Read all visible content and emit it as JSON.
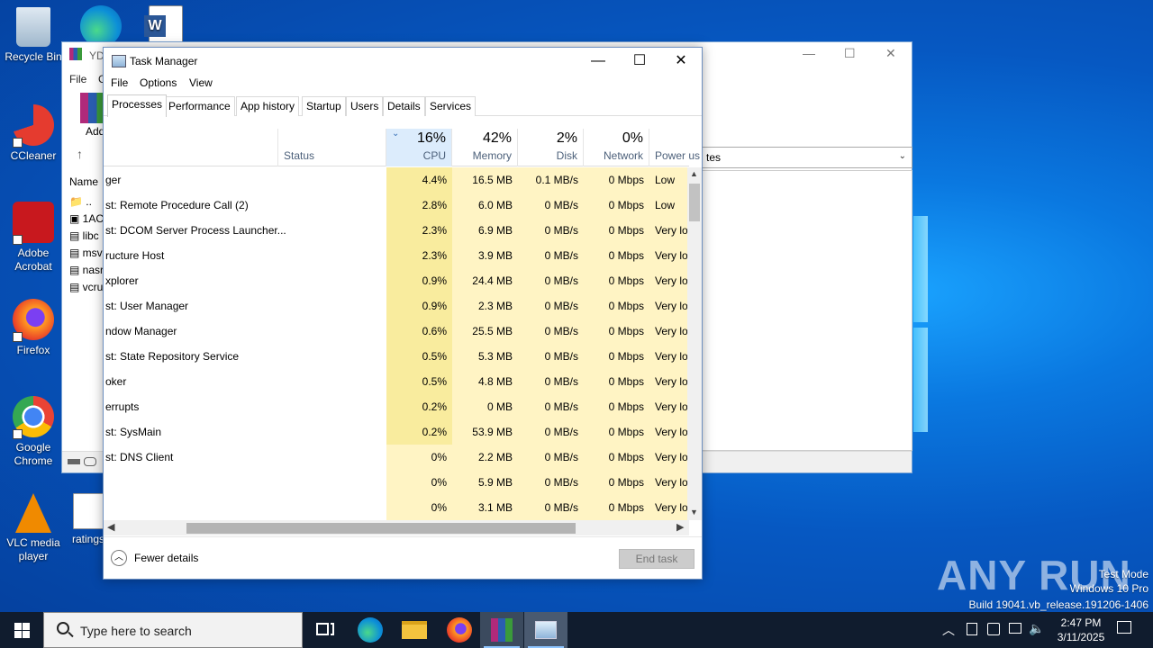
{
  "desktop": {
    "icons": [
      {
        "label": "Recycle Bin"
      },
      {
        "label": "CCleaner"
      },
      {
        "label": "Adobe Acrobat"
      },
      {
        "label": "Firefox"
      },
      {
        "label": "Google Chrome"
      },
      {
        "label": "VLC media player"
      },
      {
        "label": "ratings"
      }
    ]
  },
  "bg_window": {
    "title": "YD",
    "menu_file": "File",
    "menu_c": "C",
    "add_label": "Add",
    "col_name": "Name",
    "files": [
      "..",
      "1AC",
      "libc",
      "msv",
      "nasr",
      "vcru"
    ]
  },
  "task_manager": {
    "title": "Task Manager",
    "menu": [
      "File",
      "Options",
      "View"
    ],
    "tabs": [
      "Processes",
      "Performance",
      "App history",
      "Startup",
      "Users",
      "Details",
      "Services"
    ],
    "columns": {
      "status": "Status",
      "cpu_pct": "16%",
      "cpu": "CPU",
      "mem_pct": "42%",
      "mem": "Memory",
      "disk_pct": "2%",
      "disk": "Disk",
      "net_pct": "0%",
      "net": "Network",
      "power": "Power us"
    },
    "rows": [
      {
        "name": "ger",
        "cpu": "4.4%",
        "mem": "16.5 MB",
        "disk": "0.1 MB/s",
        "net": "0 Mbps",
        "power": "Low"
      },
      {
        "name": "st: Remote Procedure Call (2)",
        "cpu": "2.8%",
        "mem": "6.0 MB",
        "disk": "0 MB/s",
        "net": "0 Mbps",
        "power": "Low"
      },
      {
        "name": "st: DCOM Server Process Launcher...",
        "cpu": "2.3%",
        "mem": "6.9 MB",
        "disk": "0 MB/s",
        "net": "0 Mbps",
        "power": "Very lo"
      },
      {
        "name": "ructure Host",
        "cpu": "2.3%",
        "mem": "3.9 MB",
        "disk": "0 MB/s",
        "net": "0 Mbps",
        "power": "Very lo"
      },
      {
        "name": "xplorer",
        "cpu": "0.9%",
        "mem": "24.4 MB",
        "disk": "0 MB/s",
        "net": "0 Mbps",
        "power": "Very lo"
      },
      {
        "name": "st: User Manager",
        "cpu": "0.9%",
        "mem": "2.3 MB",
        "disk": "0 MB/s",
        "net": "0 Mbps",
        "power": "Very lo"
      },
      {
        "name": "ndow Manager",
        "cpu": "0.6%",
        "mem": "25.5 MB",
        "disk": "0 MB/s",
        "net": "0 Mbps",
        "power": "Very lo"
      },
      {
        "name": "st: State Repository Service",
        "cpu": "0.5%",
        "mem": "5.3 MB",
        "disk": "0 MB/s",
        "net": "0 Mbps",
        "power": "Very lo"
      },
      {
        "name": "oker",
        "cpu": "0.5%",
        "mem": "4.8 MB",
        "disk": "0 MB/s",
        "net": "0 Mbps",
        "power": "Very lo"
      },
      {
        "name": "errupts",
        "cpu": "0.2%",
        "mem": "0 MB",
        "disk": "0 MB/s",
        "net": "0 Mbps",
        "power": "Very lo"
      },
      {
        "name": "st: SysMain",
        "cpu": "0.2%",
        "mem": "53.9 MB",
        "disk": "0 MB/s",
        "net": "0 Mbps",
        "power": "Very lo"
      },
      {
        "name": "st: DNS Client",
        "cpu": "0%",
        "mem": "2.2 MB",
        "disk": "0 MB/s",
        "net": "0 Mbps",
        "power": "Very lo"
      },
      {
        "name": "",
        "cpu": "0%",
        "mem": "5.9 MB",
        "disk": "0 MB/s",
        "net": "0 Mbps",
        "power": "Very lo"
      },
      {
        "name": "",
        "cpu": "0%",
        "mem": "3.1 MB",
        "disk": "0 MB/s",
        "net": "0 Mbps",
        "power": "Very lo"
      }
    ],
    "fewer_details": "Fewer details",
    "end_task": "End task"
  },
  "taskbar": {
    "search_placeholder": "Type here to search",
    "time": "2:47 PM",
    "date": "3/11/2025"
  },
  "watermark": {
    "brand": "ANY RUN",
    "mode": "Test Mode",
    "os": "Windows 10 Pro",
    "build": "Build 19041.vb_release.191206-1406"
  },
  "colors": {
    "cpu_heat": "#fff4c4",
    "cpu_heat_strong": "#f9ec9e",
    "taskbar": "#101c2e",
    "accent": "#0078d7"
  }
}
